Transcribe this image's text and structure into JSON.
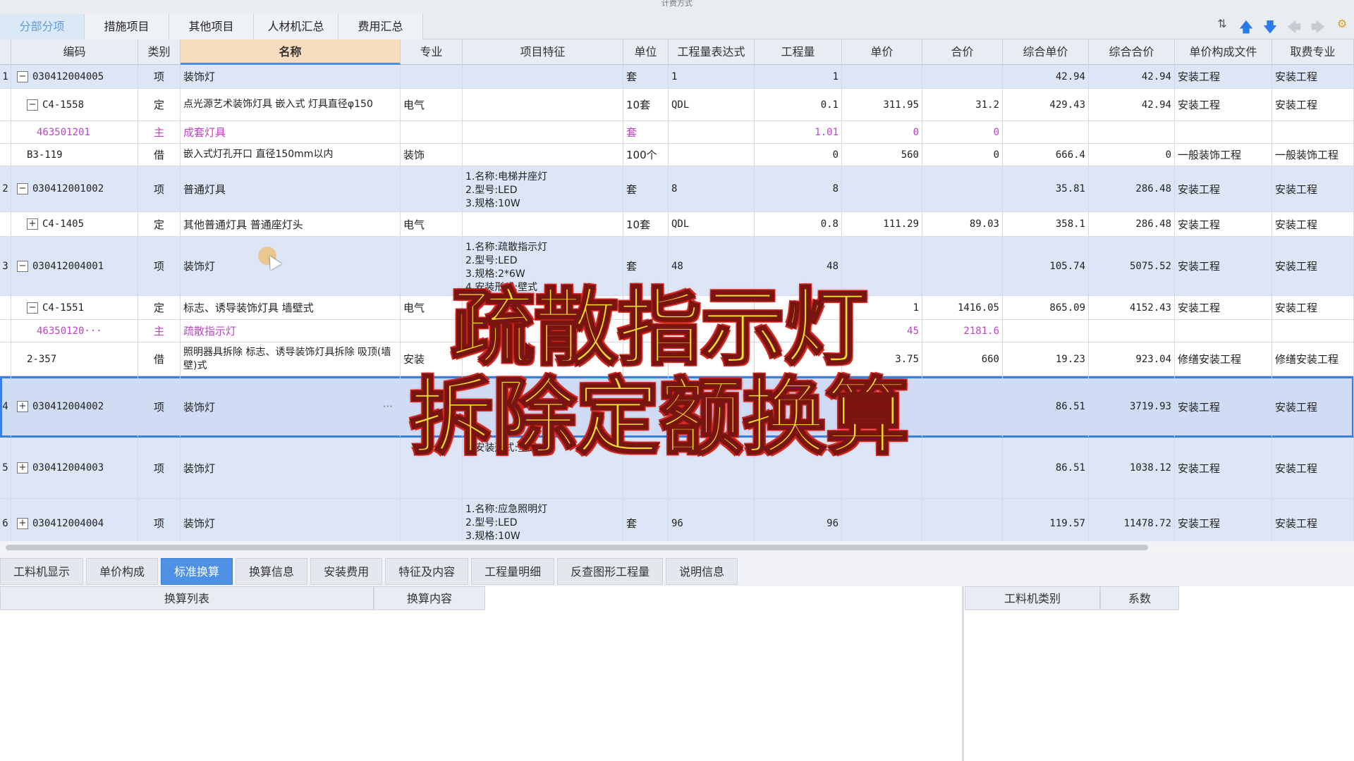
{
  "window": {
    "title": "计费方式"
  },
  "top_tabs": [
    "分部分项",
    "措施项目",
    "其他项目",
    "人材机汇总",
    "费用汇总"
  ],
  "toolbar": {
    "icons": [
      "sort-icon",
      "move-up-icon",
      "move-down-icon",
      "back-icon",
      "forward-icon",
      "settings-icon"
    ]
  },
  "grid": {
    "columns": [
      "编码",
      "类别",
      "名称",
      "专业",
      "项目特征",
      "单位",
      "工程量表达式",
      "工程量",
      "单价",
      "合价",
      "综合单价",
      "综合合价",
      "单价构成文件",
      "取费专业"
    ],
    "rows": [
      {
        "idx": "1",
        "tree": "−",
        "level": 0,
        "code": "030412004005",
        "type": "项",
        "name": "装饰灯",
        "major": "",
        "feature": "",
        "unit": "套",
        "expr": "1",
        "qty": "1",
        "price": "",
        "total": "",
        "unit_price": "42.94",
        "unit_total": "42.94",
        "file": "安装工程",
        "fee": "安装工程"
      },
      {
        "idx": "",
        "tree": "−",
        "level": 1,
        "code": "C4-1558",
        "type": "定",
        "name": "点光源艺术装饰灯具 嵌入式 灯具直径φ150",
        "major": "电气",
        "feature": "",
        "unit": "10套",
        "expr": "QDL",
        "qty": "0.1",
        "price": "311.95",
        "total": "31.2",
        "unit_price": "429.43",
        "unit_total": "42.94",
        "file": "安装工程",
        "fee": "安装工程"
      },
      {
        "idx": "",
        "tree": "",
        "level": 2,
        "code": "463501201",
        "type": "主",
        "name": "成套灯具",
        "major": "",
        "feature": "",
        "unit": "套",
        "expr": "",
        "qty": "1.01",
        "price": "0",
        "total": "0",
        "unit_price": "",
        "unit_total": "",
        "file": "",
        "fee": ""
      },
      {
        "idx": "",
        "tree": "",
        "level": 1,
        "code": "B3-119",
        "type": "借",
        "name": "嵌入式灯孔开口 直径150mm以内",
        "major": "装饰",
        "feature": "",
        "unit": "100个",
        "expr": "",
        "qty": "0",
        "price": "560",
        "total": "0",
        "unit_price": "666.4",
        "unit_total": "0",
        "file": "一般装饰工程",
        "fee": "一般装饰工程"
      },
      {
        "idx": "2",
        "tree": "−",
        "level": 0,
        "code": "030412001002",
        "type": "项",
        "name": "普通灯具",
        "major": "",
        "feature": "1.名称:电梯井座灯\n2.型号:LED\n3.规格:10W",
        "unit": "套",
        "expr": "8",
        "qty": "8",
        "price": "",
        "total": "",
        "unit_price": "35.81",
        "unit_total": "286.48",
        "file": "安装工程",
        "fee": "安装工程"
      },
      {
        "idx": "",
        "tree": "+",
        "level": 1,
        "code": "C4-1405",
        "type": "定",
        "name": "其他普通灯具 普通座灯头",
        "major": "电气",
        "feature": "",
        "unit": "10套",
        "expr": "QDL",
        "qty": "0.8",
        "price": "111.29",
        "total": "89.03",
        "unit_price": "358.1",
        "unit_total": "286.48",
        "file": "安装工程",
        "fee": "安装工程"
      },
      {
        "idx": "3",
        "tree": "−",
        "level": 0,
        "code": "030412004001",
        "type": "项",
        "name": "装饰灯",
        "major": "",
        "feature": "1.名称:疏散指示灯\n2.型号:LED\n3.规格:2*6W\n4.安装形式:壁式",
        "unit": "套",
        "expr": "48",
        "qty": "48",
        "price": "",
        "total": "",
        "unit_price": "105.74",
        "unit_total": "5075.52",
        "file": "安装工程",
        "fee": "安装工程"
      },
      {
        "idx": "",
        "tree": "−",
        "level": 1,
        "code": "C4-1551",
        "type": "定",
        "name": "标志、诱导装饰灯具 墙壁式",
        "major": "电气",
        "feature": "",
        "unit": "",
        "expr": "",
        "qty": "",
        "price": "1",
        "total": "1416.05",
        "unit_price": "865.09",
        "unit_total": "4152.43",
        "file": "安装工程",
        "fee": "安装工程"
      },
      {
        "idx": "",
        "tree": "",
        "level": 2,
        "code": "46350120···",
        "type": "主",
        "name": "疏散指示灯",
        "major": "",
        "feature": "",
        "unit": "",
        "expr": "",
        "qty": "",
        "price": "45",
        "total": "2181.6",
        "unit_price": "",
        "unit_total": "",
        "file": "",
        "fee": ""
      },
      {
        "idx": "",
        "tree": "",
        "level": 1,
        "code": "2-357",
        "type": "借",
        "name": "照明器具拆除 标志、诱导装饰灯具拆除 吸顶(墙壁)式",
        "major": "安装",
        "feature": "",
        "unit": "",
        "expr": "",
        "qty": "",
        "price": "3.75",
        "total": "660",
        "unit_price": "19.23",
        "unit_total": "923.04",
        "file": "修缮安装工程",
        "fee": "修缮安装工程"
      },
      {
        "idx": "4",
        "tree": "+",
        "level": 0,
        "code": "030412004002",
        "type": "项",
        "name": "装饰灯",
        "major": "",
        "feature": "",
        "unit": "",
        "expr": "",
        "qty": "",
        "price": "",
        "total": "",
        "unit_price": "86.51",
        "unit_total": "3719.93",
        "file": "安装工程",
        "fee": "安装工程"
      },
      {
        "idx": "5",
        "tree": "+",
        "level": 0,
        "code": "030412004003",
        "type": "项",
        "name": "装饰灯",
        "major": "",
        "feature": "4.安装形式:壁式",
        "unit": "",
        "expr": "",
        "qty": "",
        "price": "",
        "total": "",
        "unit_price": "86.51",
        "unit_total": "1038.12",
        "file": "安装工程",
        "fee": "安装工程"
      },
      {
        "idx": "6",
        "tree": "+",
        "level": 0,
        "code": "030412004004",
        "type": "项",
        "name": "装饰灯",
        "major": "",
        "feature": "1.名称:应急照明灯\n2.型号:LED\n3.规格:10W",
        "unit": "套",
        "expr": "96",
        "qty": "96",
        "price": "",
        "total": "",
        "unit_price": "119.57",
        "unit_total": "11478.72",
        "file": "安装工程",
        "fee": "安装工程"
      }
    ]
  },
  "bottom_tabs": [
    "工料机显示",
    "单价构成",
    "标准换算",
    "换算信息",
    "安装费用",
    "特征及内容",
    "工程量明细",
    "反查图形工程量",
    "说明信息"
  ],
  "bottom_headers": {
    "list": "换算列表",
    "content": "换算内容",
    "category": "工料机类别",
    "coef": "系数"
  },
  "overlay": {
    "line1": "疏散指示灯",
    "line2": "拆除定额换算"
  }
}
